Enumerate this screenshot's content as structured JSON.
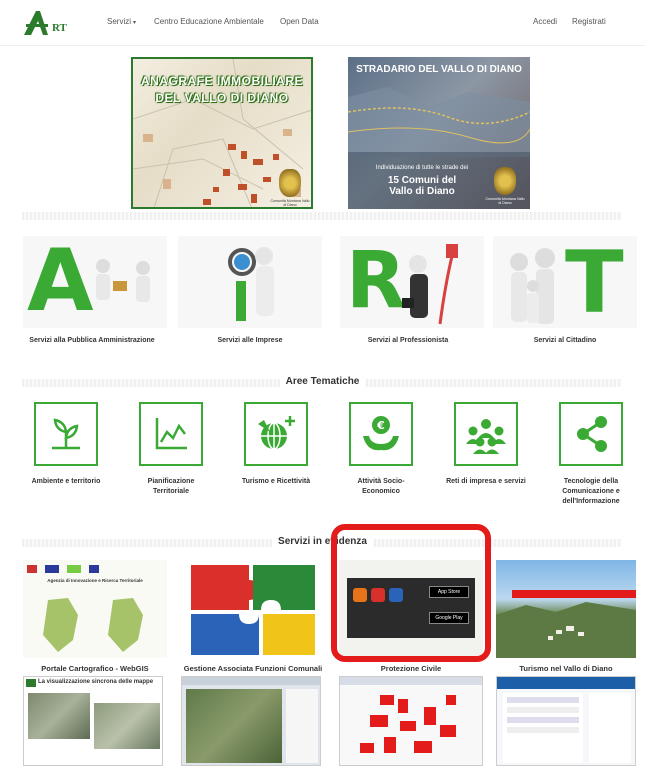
{
  "navbar": {
    "logo_text": "ATRT",
    "links": [
      {
        "label": "Servizi",
        "icon": "caret-down-icon"
      },
      {
        "label": "Centro Educazione Ambientale"
      },
      {
        "label": "Open Data"
      }
    ],
    "right_links": [
      {
        "label": "Accedi"
      },
      {
        "label": "Registrati"
      }
    ]
  },
  "banners": [
    {
      "title_line1": "ANAGRAFE IMMOBILIARE",
      "title_line2": "DEL VALLO DI DIANO"
    },
    {
      "title": "STRADARIO DEL VALLO DI DIANO",
      "subtitle": "Individuazione di tutte le strade dei",
      "big_line1": "15 Comuni del",
      "big_line2": "Vallo di Diano",
      "seal_caption": "Comunità Montana Vallo di Diano"
    }
  ],
  "services": [
    {
      "label": "Servizi alla Pubblica Amministrazione",
      "letter": "A"
    },
    {
      "label": "Servizi alle Imprese",
      "letter": "i"
    },
    {
      "label": "Servizi al Professionista",
      "letter": "R"
    },
    {
      "label": "Servizi al Cittadino",
      "letter": "T"
    }
  ],
  "themes_title": "Aree Tematiche",
  "themes": [
    {
      "label_line1": "Ambiente e territorio",
      "label_line2": "",
      "label_line3": "",
      "icon": "plant-icon"
    },
    {
      "label_line1": "Pianificazione",
      "label_line2": "Territoriale",
      "label_line3": "",
      "icon": "chart-icon"
    },
    {
      "label_line1": "Turismo e Ricettività",
      "label_line2": "",
      "label_line3": "",
      "icon": "globe-plane-icon"
    },
    {
      "label_line1": "Attività Socio-",
      "label_line2": "Economico",
      "label_line3": "",
      "icon": "hands-euro-icon"
    },
    {
      "label_line1": "Reti di impresa e servizi",
      "label_line2": "",
      "label_line3": "",
      "icon": "network-people-icon"
    },
    {
      "label_line1": "Tecnologie della",
      "label_line2": "Comunicazione e",
      "label_line3": "dell'Informazione",
      "icon": "share-icon"
    }
  ],
  "highlights_title": "Servizi in evidenza",
  "highlights": [
    {
      "label": "Portale Cartografico - WebGIS",
      "image_title": "Agenzia di Innovazione e Ricerca Territoriale"
    },
    {
      "label": "Gestione Associata Funzioni Comunali"
    },
    {
      "label": "Protezione Civile",
      "app_store": "App Store",
      "google_play": "Google Play"
    },
    {
      "label": "Turismo nel Vallo di Diano"
    }
  ],
  "screenshots": [
    {
      "caption": "La visualizzazione sincrona delle mappe"
    }
  ],
  "colors": {
    "accent_green": "#3aaa35",
    "highlight_red": "#e31b1b",
    "logo_green": "#2c7a2c"
  }
}
